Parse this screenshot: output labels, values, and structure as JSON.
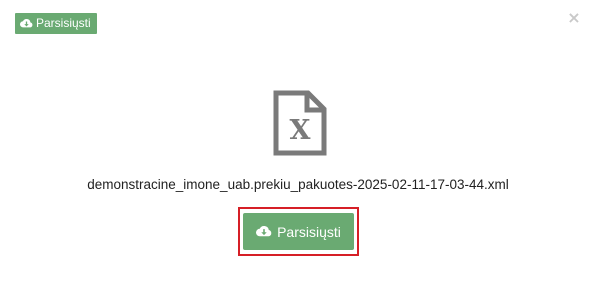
{
  "dialog": {
    "top_download_label": "Parsisiųsti",
    "close_symbol": "×",
    "file_icon_letter": "X",
    "file_name": "demonstracine_imone_uab.prekiu_pakuotes-2025-02-11-17-03-44.xml",
    "main_download_label": "Parsisiųsti"
  },
  "icons": {
    "download": "cloud-download-icon",
    "file": "xml-file-icon",
    "close": "close-icon"
  },
  "colors": {
    "button_green": "#6aaa72",
    "highlight_red": "#d61f26",
    "file_icon_gray": "#7a7a7a",
    "close_gray": "#c9c9c9"
  }
}
